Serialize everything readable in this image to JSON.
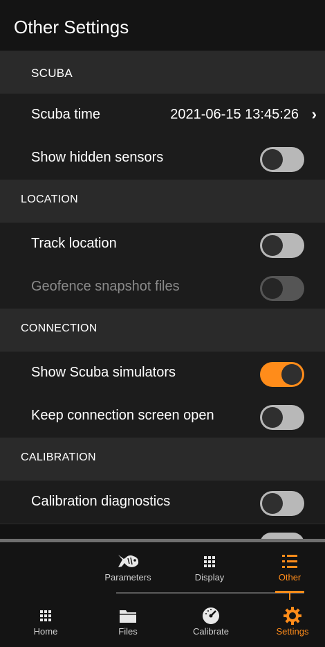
{
  "header": {
    "title": "Other Settings"
  },
  "sections": {
    "scuba": "SCUBA",
    "location": "LOCATION",
    "connection": "CONNECTION",
    "calibration": "CALIBRATION"
  },
  "rows": {
    "scuba_time": {
      "label": "Scuba time",
      "value": "2021-06-15 13:45:26"
    },
    "show_hidden_sensors": {
      "label": "Show hidden sensors",
      "on": false
    },
    "track_location": {
      "label": "Track location",
      "on": false
    },
    "geofence_snapshot": {
      "label": "Geofence snapshot files",
      "on": false,
      "disabled": true
    },
    "show_scuba_simulators": {
      "label": "Show Scuba simulators",
      "on": true
    },
    "keep_connection_open": {
      "label": "Keep connection screen open",
      "on": false
    },
    "calibration_diagnostics": {
      "label": "Calibration diagnostics",
      "on": false
    }
  },
  "subtabs": [
    {
      "label": "Parameters",
      "icon": "fish-icon"
    },
    {
      "label": "Display",
      "icon": "grid-icon"
    },
    {
      "label": "Other",
      "icon": "list-icon",
      "active": true
    }
  ],
  "tabs": [
    {
      "label": "Home",
      "icon": "grid-icon"
    },
    {
      "label": "Files",
      "icon": "folder-icon"
    },
    {
      "label": "Calibrate",
      "icon": "gauge-icon"
    },
    {
      "label": "Settings",
      "icon": "gear-icon",
      "active": true
    }
  ],
  "colors": {
    "accent": "#ff8c1a",
    "background": "#121212"
  }
}
